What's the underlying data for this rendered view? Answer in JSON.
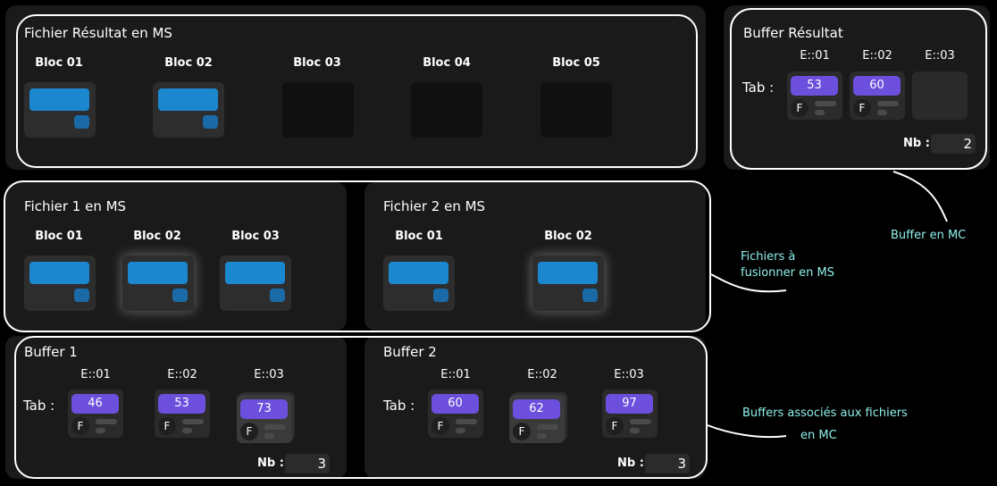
{
  "result_file": {
    "title": "Fichier Résultat en MS",
    "blocs": [
      {
        "label": "Bloc 01",
        "filled": true
      },
      {
        "label": "Bloc 02",
        "filled": true
      },
      {
        "label": "Bloc 03",
        "filled": false
      },
      {
        "label": "Bloc 04",
        "filled": false
      },
      {
        "label": "Bloc 05",
        "filled": false
      }
    ]
  },
  "result_buffer": {
    "title": "Buffer Résultat",
    "tab_label": "Tab :",
    "columns": [
      "E::01",
      "E::02",
      "E::03"
    ],
    "cells": [
      {
        "value": "53",
        "flag": "F"
      },
      {
        "value": "60",
        "flag": "F"
      },
      {
        "value": "",
        "flag": ""
      }
    ],
    "nb_label": "Nb :",
    "nb_value": "2"
  },
  "file1": {
    "title": "Fichier 1 en MS",
    "blocs": [
      {
        "label": "Bloc 01",
        "filled": true
      },
      {
        "label": "Bloc 02",
        "filled": true,
        "highlighted": true
      },
      {
        "label": "Bloc 03",
        "filled": true
      }
    ]
  },
  "file2": {
    "title": "Fichier 2 en MS",
    "blocs": [
      {
        "label": "Bloc 01",
        "filled": true
      },
      {
        "label": "Bloc 02",
        "filled": true,
        "highlighted": true
      }
    ]
  },
  "buffer1": {
    "title": "Buffer 1",
    "tab_label": "Tab :",
    "columns": [
      "E::01",
      "E::02",
      "E::03"
    ],
    "cells": [
      {
        "value": "46",
        "flag": "F"
      },
      {
        "value": "53",
        "flag": "F"
      },
      {
        "value": "73",
        "flag": "F"
      }
    ],
    "nb_label": "Nb :",
    "nb_value": "3"
  },
  "buffer2": {
    "title": "Buffer 2",
    "tab_label": "Tab :",
    "columns": [
      "E::01",
      "E::02",
      "E::03"
    ],
    "cells": [
      {
        "value": "60",
        "flag": "F"
      },
      {
        "value": "62",
        "flag": "F"
      },
      {
        "value": "97",
        "flag": "F"
      }
    ],
    "nb_label": "Nb :",
    "nb_value": "3"
  },
  "annotations": {
    "buffer_mc": "Buffer en MC",
    "files_ms_line1": "Fichiers à",
    "files_ms_line2": "fusionner en MS",
    "buffers_mc_line1": "Buffers associés aux fichiers",
    "buffers_mc_line2": "en MC"
  },
  "colors": {
    "background": "#000000",
    "panel": "#1a1a1a",
    "bloc_bar": "#1b87cf",
    "cell_value": "#6c4fdc",
    "annotation": "#8ff0ea"
  }
}
